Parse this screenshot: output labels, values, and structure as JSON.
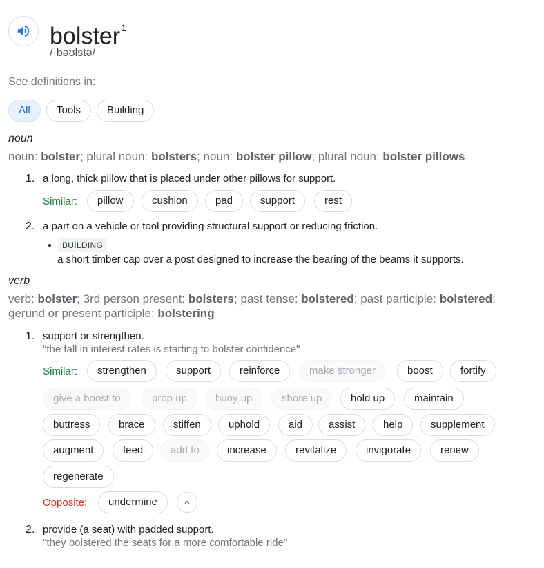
{
  "header": {
    "word": "bolster",
    "superscript": "1",
    "phonetic": "/ˈbəʊlstə/",
    "speaker_icon": "volume-icon"
  },
  "see_definitions": {
    "label": "See definitions in:",
    "chips": [
      "All",
      "Tools",
      "Building"
    ]
  },
  "noun": {
    "label": "noun",
    "forms": {
      "p1": "noun: ",
      "b1": "bolster",
      "p2": "; plural noun: ",
      "b2": "bolsters",
      "p3": "; noun: ",
      "b3": "bolster pillow",
      "p4": "; plural noun: ",
      "b4": "bolster pillows"
    },
    "senses": [
      {
        "num": "1.",
        "definition": "a long, thick pillow that is placed under other pillows for support.",
        "similar_label": "Similar:",
        "similar": [
          "pillow",
          "cushion",
          "pad",
          "support",
          "rest"
        ]
      },
      {
        "num": "2.",
        "definition": "a part on a vehicle or tool providing structural support or reducing friction.",
        "sub_tag": "BUILDING",
        "sub_definition": "a short timber cap over a post designed to increase the bearing of the beams it supports."
      }
    ]
  },
  "verb": {
    "label": "verb",
    "forms": {
      "p1": "verb: ",
      "b1": "bolster",
      "p2": "; 3rd person present: ",
      "b2": "bolsters",
      "p3": "; past tense: ",
      "b3": "bolstered",
      "p4": "; past participle: ",
      "b4": "bolstered",
      "p5": ";",
      "p6": "gerund or present participle: ",
      "b6": "bolstering"
    },
    "senses": [
      {
        "num": "1.",
        "definition": "support or strengthen.",
        "example": "\"the fall in interest rates is starting to bolster confidence\"",
        "similar_label": "Similar:",
        "similar_rows": [
          [
            [
              "strengthen",
              false
            ],
            [
              "support",
              false
            ],
            [
              "reinforce",
              false
            ],
            [
              "make stronger",
              true
            ],
            [
              "boost",
              false
            ],
            [
              "fortify",
              false
            ]
          ],
          [
            [
              "give a boost to",
              true
            ],
            [
              "prop up",
              true
            ],
            [
              "buoy up",
              true
            ],
            [
              "shore up",
              true
            ],
            [
              "hold up",
              false
            ],
            [
              "maintain",
              false
            ]
          ],
          [
            [
              "buttress",
              false
            ],
            [
              "brace",
              false
            ],
            [
              "stiffen",
              false
            ],
            [
              "uphold",
              false
            ],
            [
              "aid",
              false
            ],
            [
              "assist",
              false
            ],
            [
              "help",
              false
            ],
            [
              "supplement",
              false
            ]
          ],
          [
            [
              "augment",
              false
            ],
            [
              "feed",
              false
            ],
            [
              "add to",
              true
            ],
            [
              "increase",
              false
            ],
            [
              "revitalize",
              false
            ],
            [
              "invigorate",
              false
            ],
            [
              "renew",
              false
            ]
          ],
          [
            [
              "regenerate",
              false
            ]
          ]
        ],
        "opposite_label": "Opposite:",
        "opposite": [
          "undermine"
        ],
        "collapse_icon": "chevron-up-icon"
      },
      {
        "num": "2.",
        "definition": "provide (a seat) with padded support.",
        "example": "\"they bolstered the seats for a more comfortable ride\""
      }
    ]
  }
}
